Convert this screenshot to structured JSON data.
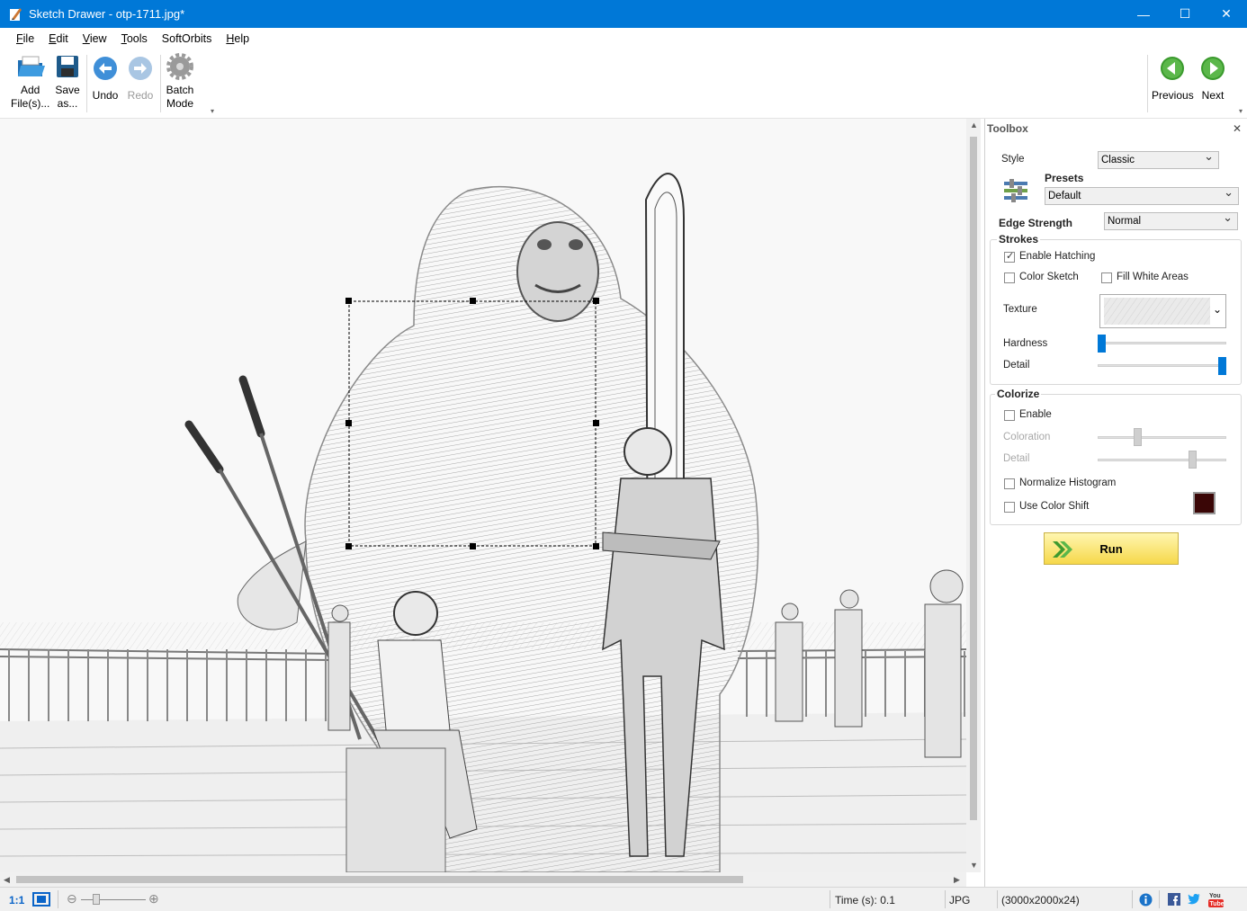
{
  "window": {
    "title": "Sketch Drawer - otp-1711.jpg*"
  },
  "menu": [
    {
      "u": "F",
      "rest": "ile"
    },
    {
      "u": "E",
      "rest": "dit"
    },
    {
      "u": "V",
      "rest": "iew"
    },
    {
      "u": "T",
      "rest": "ools"
    },
    {
      "u": "",
      "rest": "SoftOrbits"
    },
    {
      "u": "H",
      "rest": "elp"
    }
  ],
  "toolbar": {
    "add": "Add\nFile(s)...",
    "add_l1": "Add",
    "add_l2": "File(s)...",
    "save_l1": "Save",
    "save_l2": "as...",
    "undo": "Undo",
    "redo": "Redo",
    "batch_l1": "Batch",
    "batch_l2": "Mode",
    "previous": "Previous",
    "next": "Next"
  },
  "toolbox": {
    "title": "Toolbox",
    "style_label": "Style",
    "style_value": "Classic",
    "presets_label": "Presets",
    "presets_value": "Default",
    "edge_label": "Edge Strength",
    "edge_value": "Normal",
    "strokes": {
      "title": "Strokes",
      "enable_hatching": "Enable Hatching",
      "enable_hatching_checked": true,
      "color_sketch": "Color Sketch",
      "fill_white": "Fill White Areas",
      "texture_label": "Texture",
      "hardness_label": "Hardness",
      "hardness_value": 0.0,
      "detail_label": "Detail",
      "detail_value": 1.0
    },
    "colorize": {
      "title": "Colorize",
      "enable": "Enable",
      "coloration": "Coloration",
      "coloration_value": 0.3,
      "detail": "Detail",
      "detail_value": 0.75,
      "normalize": "Normalize Histogram",
      "color_shift": "Use Color Shift",
      "shift_color": "#3a0606"
    },
    "run": "Run"
  },
  "status": {
    "zoom_label": "1:1",
    "time": "Time (s): 0.1",
    "format": "JPG",
    "dims": "(3000x2000x24)"
  },
  "colors": {
    "titlebar": "#0078d7",
    "accent": "#0078d7"
  }
}
